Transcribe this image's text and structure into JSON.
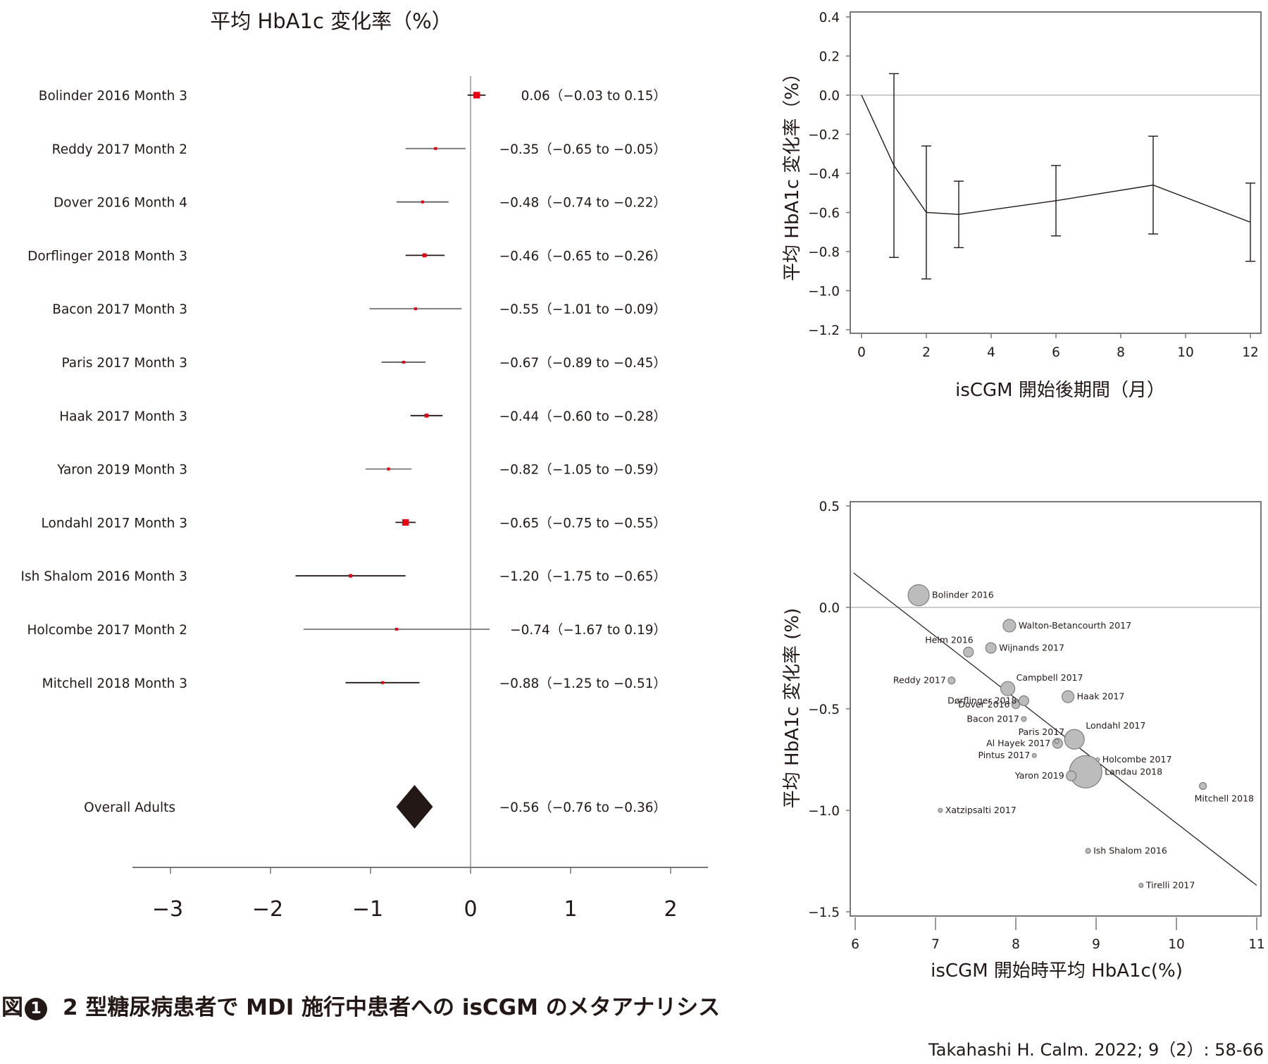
{
  "chart_data": [
    {
      "type": "forest",
      "title": "平均 HbA1c 変化率（%）",
      "xlim": [
        -3.4,
        2.4
      ],
      "xticks": [
        -3,
        -2,
        -1,
        0,
        1,
        2
      ],
      "xtick_labels": [
        "−3",
        "−2",
        "−1",
        "0",
        "1",
        "2"
      ],
      "studies": [
        {
          "label": "Bolinder 2016 Month 3",
          "mean": 0.06,
          "lower": -0.03,
          "upper": 0.15,
          "text": "0.06（−0.03 to 0.15）",
          "weight": 3,
          "ci_color": "#231815"
        },
        {
          "label": "Reddy 2017 Month 2",
          "mean": -0.35,
          "lower": -0.65,
          "upper": -0.05,
          "text": "−0.35（−0.65 to −0.05）",
          "weight": 1,
          "ci_color": "#777777"
        },
        {
          "label": "Dover 2016 Month 4",
          "mean": -0.48,
          "lower": -0.74,
          "upper": -0.22,
          "text": "−0.48（−0.74 to −0.22）",
          "weight": 1,
          "ci_color": "#555555"
        },
        {
          "label": "Dorflinger 2018 Month 3",
          "mean": -0.46,
          "lower": -0.65,
          "upper": -0.26,
          "text": "−0.46（−0.65 to −0.26）",
          "weight": 1.6,
          "ci_color": "#231815"
        },
        {
          "label": "Bacon 2017 Month 3",
          "mean": -0.55,
          "lower": -1.01,
          "upper": -0.09,
          "text": "−0.55（−1.01 to −0.09）",
          "weight": 1,
          "ci_color": "#777777"
        },
        {
          "label": "Paris 2017 Month 3",
          "mean": -0.67,
          "lower": -0.89,
          "upper": -0.45,
          "text": "−0.67（−0.89 to −0.45）",
          "weight": 1,
          "ci_color": "#555555"
        },
        {
          "label": "Haak 2017 Month 3",
          "mean": -0.44,
          "lower": -0.6,
          "upper": -0.28,
          "text": "−0.44（−0.60 to −0.28）",
          "weight": 1.6,
          "ci_color": "#231815"
        },
        {
          "label": "Yaron 2019 Month 3",
          "mean": -0.82,
          "lower": -1.05,
          "upper": -0.59,
          "text": "−0.82（−1.05 to −0.59）",
          "weight": 1,
          "ci_color": "#777777"
        },
        {
          "label": "Londahl 2017 Month 3",
          "mean": -0.65,
          "lower": -0.75,
          "upper": -0.55,
          "text": "−0.65（−0.75 to −0.55）",
          "weight": 3,
          "ci_color": "#231815"
        },
        {
          "label": "Ish Shalom 2016 Month 3",
          "mean": -1.2,
          "lower": -1.75,
          "upper": -0.65,
          "text": "−1.20（−1.75 to −0.65）",
          "weight": 1.3,
          "ci_color": "#231815"
        },
        {
          "label": "Holcombe 2017 Month 2",
          "mean": -0.74,
          "lower": -1.67,
          "upper": 0.19,
          "text": "−0.74（−1.67 to 0.19）",
          "weight": 1,
          "ci_color": "#777777"
        },
        {
          "label": "Mitchell 2018 Month 3",
          "mean": -0.88,
          "lower": -1.25,
          "upper": -0.51,
          "text": "−0.88（−1.25 to −0.51）",
          "weight": 1,
          "ci_color": "#231815"
        }
      ],
      "overall": {
        "label": "Overall Adults",
        "mean": -0.56,
        "lower": -0.76,
        "upper": -0.36,
        "text": "−0.56（−0.76 to −0.36）"
      },
      "marker_color": "#e60012",
      "diamond_color": "#231815"
    },
    {
      "type": "line",
      "ylabel": "平均 HbA1c 変化率（%）",
      "xlabel": "isCGM 開始後期間（月）",
      "xlim": [
        -0.4,
        12.4
      ],
      "ylim": [
        -1.25,
        0.42
      ],
      "xticks": [
        0,
        2,
        4,
        6,
        8,
        10,
        12
      ],
      "yticks": [
        0.4,
        0.2,
        0.0,
        -0.2,
        -0.4,
        -0.6,
        -0.8,
        -1.0,
        -1.2
      ],
      "ytick_labels": [
        "0.4",
        "0.2",
        "0.0",
        "−0.2",
        "−0.4",
        "−0.6",
        "−0.8",
        "−1.0",
        "−1.2"
      ],
      "reference_line_y": 0,
      "x": [
        0,
        1,
        2,
        3,
        6,
        9,
        12
      ],
      "y": [
        0.0,
        -0.36,
        -0.6,
        -0.61,
        -0.54,
        -0.46,
        -0.65
      ],
      "error_bars": [
        null,
        {
          "x": 1,
          "lower": -0.83,
          "upper": 0.11
        },
        {
          "x": 2,
          "lower": -0.94,
          "upper": -0.26
        },
        {
          "x": 3,
          "lower": -0.78,
          "upper": -0.44
        },
        {
          "x": 6,
          "lower": -0.72,
          "upper": -0.36
        },
        {
          "x": 9,
          "lower": -0.71,
          "upper": -0.21
        },
        {
          "x": 12,
          "lower": -0.85,
          "upper": -0.45
        }
      ],
      "grid": false
    },
    {
      "type": "scatter",
      "subtype": "bubble",
      "ylabel": "平均 HbA1c 変化率 (%)",
      "xlabel": "isCGM 開始時平均 HbA1c(%)",
      "xlim": [
        5.95,
        11.05
      ],
      "ylim": [
        -1.53,
        0.52
      ],
      "xticks": [
        6,
        7,
        8,
        9,
        10,
        11
      ],
      "yticks": [
        0.5,
        0.0,
        -0.5,
        -1.0,
        -1.5
      ],
      "ytick_labels": [
        "0.5",
        "0.0",
        "−0.5",
        "−1.0",
        "−1.5"
      ],
      "reference_line_y": 0,
      "regression_line": {
        "x": [
          5.98,
          11.0
        ],
        "y": [
          0.17,
          -1.37
        ]
      },
      "bubble_color": "#bcbcbd",
      "bubble_stroke": "#777777",
      "points": [
        {
          "label": "Bolinder 2016",
          "x": 6.79,
          "y": 0.06,
          "size": 15,
          "label_pos": "right"
        },
        {
          "label": "Walton-Betancourth 2017",
          "x": 7.92,
          "y": -0.09,
          "size": 9,
          "label_pos": "right"
        },
        {
          "label": "Helm 2016",
          "x": 7.41,
          "y": -0.22,
          "size": 7,
          "label_pos": "top-left"
        },
        {
          "label": "Wijnands 2017",
          "x": 7.69,
          "y": -0.2,
          "size": 7.5,
          "label_pos": "right"
        },
        {
          "label": "Reddy 2017",
          "x": 7.2,
          "y": -0.36,
          "size": 5,
          "label_pos": "left"
        },
        {
          "label": "Campbell 2017",
          "x": 7.9,
          "y": -0.4,
          "size": 10,
          "label_pos": "top-right"
        },
        {
          "label": "Haak 2017",
          "x": 8.65,
          "y": -0.44,
          "size": 8.5,
          "label_pos": "right"
        },
        {
          "label": "Dørflinger 2018",
          "x": 8.1,
          "y": -0.46,
          "size": 7,
          "label_pos": "left"
        },
        {
          "label": "Dover 2016",
          "x": 8.0,
          "y": -0.48,
          "size": 5.5,
          "label_pos": "left"
        },
        {
          "label": "Bacon 2017",
          "x": 8.1,
          "y": -0.55,
          "size": 3.5,
          "label_pos": "left"
        },
        {
          "label": "Paris 2017",
          "x": 8.51,
          "y": -0.66,
          "size": 3,
          "label_pos": "top-left"
        },
        {
          "label": "Al Hayek 2017",
          "x": 8.52,
          "y": -0.67,
          "size": 7,
          "label_pos": "left"
        },
        {
          "label": "Londahl 2017",
          "x": 8.73,
          "y": -0.65,
          "size": 14,
          "label_pos": "top-right"
        },
        {
          "label": "Pintus 2017",
          "x": 8.23,
          "y": -0.73,
          "size": 3,
          "label_pos": "left"
        },
        {
          "label": "Holcombe 2017",
          "x": 9.02,
          "y": -0.75,
          "size": 2.5,
          "label_pos": "right"
        },
        {
          "label": "Yaron 2019",
          "x": 8.69,
          "y": -0.83,
          "size": 7,
          "label_pos": "left"
        },
        {
          "label": "Landau 2018",
          "x": 8.87,
          "y": -0.81,
          "size": 23,
          "label_pos": "right"
        },
        {
          "label": "Mitchell 2018",
          "x": 10.33,
          "y": -0.88,
          "size": 5,
          "label_pos": "bottom"
        },
        {
          "label": "Xatzipsalti 2017",
          "x": 7.06,
          "y": -1.0,
          "size": 3,
          "label_pos": "right"
        },
        {
          "label": "Ish Shalom 2016",
          "x": 8.9,
          "y": -1.2,
          "size": 3.5,
          "label_pos": "right"
        },
        {
          "label": "Tirelli 2017",
          "x": 9.56,
          "y": -1.37,
          "size": 3,
          "label_pos": "right"
        }
      ],
      "grid": false
    }
  ],
  "figure": {
    "caption_prefix": "図",
    "caption_number": "1",
    "caption_text": "2 型糖尿病患者で MDI 施行中患者への isCGM のメタアナリシス",
    "citation": "Takahashi H. Calm. 2022; 9（2）: 58-66"
  }
}
